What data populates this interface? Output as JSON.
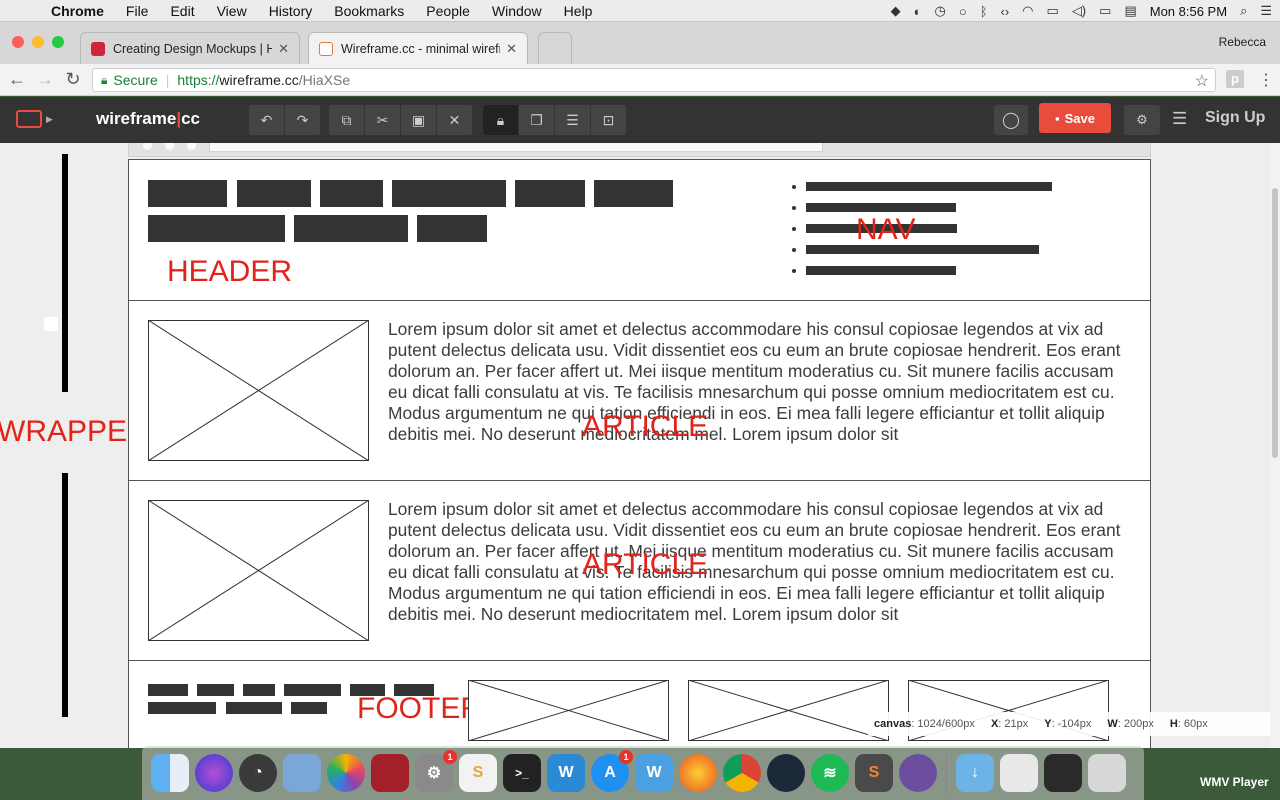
{
  "menubar": {
    "app": "Chrome",
    "items": [
      "File",
      "Edit",
      "View",
      "History",
      "Bookmarks",
      "People",
      "Window",
      "Help"
    ],
    "clock": "Mon 8:56 PM"
  },
  "browser": {
    "tabs": [
      {
        "title": "Creating Design Mockups | HT"
      },
      {
        "title": "Wireframe.cc - minimal wirefra"
      }
    ],
    "profile": "Rebecca",
    "address": {
      "secure_label": "Secure",
      "scheme": "https://",
      "host": "wireframe.cc",
      "path": "/HiaXSe"
    }
  },
  "toolbar": {
    "brand_left": "wireframe",
    "brand_sep": "|",
    "brand_right": "cc",
    "save_label": "Save",
    "signup_label": "Sign Up"
  },
  "wireframe": {
    "labels": {
      "header": "HEADER",
      "nav": "NAV",
      "wrapper": "WRAPPER",
      "article1": "ARTICLE",
      "article2": "ARTICLE",
      "footer": "FOOTER"
    },
    "lorem": "Lorem ipsum dolor sit amet et delectus accommodare his consul copiosae legendos at vix ad putent delectus delicata usu. Vidit dissentiet eos cu eum an brute copiosae hendrerit. Eos erant dolorum an. Per facer affert ut. Mei iisque mentitum moderatius cu. Sit munere facilis accusam eu dicat falli consulatu at vis. Te facilisis mnesarchum qui posse omnium mediocritatem est cu. Modus argumentum ne qui tation efficiendi in eos. Ei mea falli legere efficiantur et tollit aliquip debitis mei. No deserunt mediocritatem mel. Lorem ipsum dolor sit"
  },
  "status": {
    "canvas_label": "canvas",
    "canvas_value": ": 1024/600px",
    "x_label": "X",
    "x_value": ": 21px",
    "y_label": "Y",
    "y_value": ": -104px",
    "w_label": "W",
    "w_value": ": 200px",
    "h_label": "H",
    "h_value": ": 60px"
  },
  "dock": {
    "icons": [
      "finder-icon",
      "siri-icon",
      "launchpad-icon",
      "preview-icon",
      "photos-icon",
      "photo-booth-icon",
      "system-preferences-icon",
      "sketch-icon",
      "terminal-icon",
      "wunderlist-icon",
      "app-store-icon",
      "wunderbucket-icon",
      "firefox-icon",
      "chrome-icon",
      "steam-icon",
      "spotify-icon",
      "sublime-text-icon",
      "github-icon",
      "downloads-icon",
      "document-stack-icon",
      "terminal-window-icon",
      "trash-icon"
    ],
    "badges": {
      "system-preferences-icon": "1",
      "app-store-icon": "1"
    }
  },
  "wmv_label": "WMV Player"
}
